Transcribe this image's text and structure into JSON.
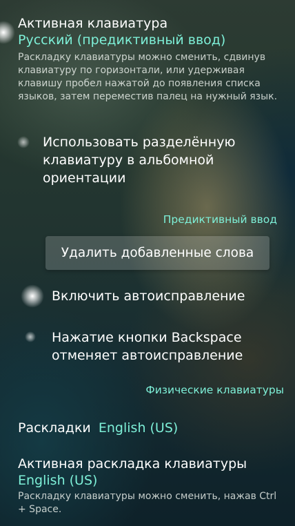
{
  "active_keyboard": {
    "title": "Активная клавиатура",
    "value": "Русский (предиктивный ввод)",
    "description": "Раскладку клавиатуры можно сменить, сдвинув клавиатуру по горизонтали, или удерживая клавишу пробел нажатой до появления списка языков, затем переместив палец на нужный язык."
  },
  "split_keyboard": {
    "label": "Использовать разделённую клавиатуру в альбомной ориентации",
    "checked": false
  },
  "predictive_section": {
    "header": "Предиктивный ввод",
    "delete_words_button": "Удалить добавленные слова"
  },
  "autocorrect": {
    "label": "Включить автоисправление",
    "checked": true
  },
  "backspace_undo": {
    "label": "Нажатие кнопки Backspace отменяет автоисправление",
    "checked": false
  },
  "physical_section": {
    "header": "Физические клавиатуры"
  },
  "layouts": {
    "label": "Раскладки",
    "value": "English (US)"
  },
  "active_layout": {
    "title": "Активная раскладка клавиатуры",
    "value": "English (US)",
    "description": "Раскладку клавиатуры можно сменить, нажав Ctrl + Space."
  },
  "colors": {
    "accent": "#7ef0d8",
    "text": "#ffffff"
  }
}
